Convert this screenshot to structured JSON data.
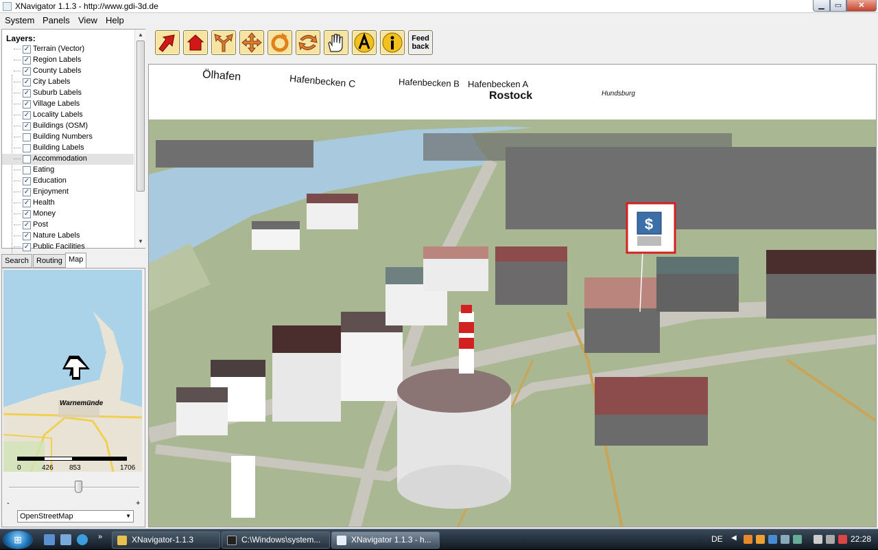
{
  "window": {
    "title": "XNavigator 1.1.3 - http://www.gdi-3d.de"
  },
  "menu": [
    "System",
    "Panels",
    "View",
    "Help"
  ],
  "layers": {
    "header": "Layers:",
    "items": [
      {
        "label": "Terrain (Vector)",
        "checked": true
      },
      {
        "label": "Region Labels",
        "checked": true
      },
      {
        "label": "County Labels",
        "checked": true
      },
      {
        "label": "City Labels",
        "checked": true
      },
      {
        "label": "Suburb Labels",
        "checked": true
      },
      {
        "label": "Village Labels",
        "checked": true
      },
      {
        "label": "Locality Labels",
        "checked": true
      },
      {
        "label": "Buildings (OSM)",
        "checked": true
      },
      {
        "label": "Building Numbers",
        "checked": false
      },
      {
        "label": "Building Labels",
        "checked": false
      },
      {
        "label": "Accommodation",
        "checked": false,
        "selected": true
      },
      {
        "label": "Eating",
        "checked": false
      },
      {
        "label": "Education",
        "checked": true
      },
      {
        "label": "Enjoyment",
        "checked": true
      },
      {
        "label": "Health",
        "checked": true
      },
      {
        "label": "Money",
        "checked": true
      },
      {
        "label": "Post",
        "checked": true
      },
      {
        "label": "Nature Labels",
        "checked": true
      },
      {
        "label": "Public Facilities",
        "checked": true
      }
    ]
  },
  "tabs": [
    "Search",
    "Routing",
    "Map"
  ],
  "active_tab": "Map",
  "minimap": {
    "place_label": "Warnemünde",
    "scale": [
      "0",
      "426",
      "853",
      "1706"
    ],
    "zoom_minus": "-",
    "zoom_plus": "+",
    "map_source": "OpenStreetMap"
  },
  "toolbar": {
    "feedback_label": "Feed back",
    "tools": [
      "fly-icon",
      "home-icon",
      "split-icon",
      "move-icon",
      "rotate-icon",
      "turn-icon",
      "hand-icon",
      "text-icon",
      "info-icon"
    ]
  },
  "scene": {
    "labels": [
      {
        "text": "Ölhafen"
      },
      {
        "text": "Hafenbecken C"
      },
      {
        "text": "Hafenbecken B"
      },
      {
        "text": "Hafenbecken A"
      },
      {
        "text": "Rostock"
      },
      {
        "text": "Hundsburg"
      }
    ]
  },
  "taskbar": {
    "tasks": [
      {
        "label": "XNavigator-1.1.3",
        "active": false
      },
      {
        "label": "C:\\Windows\\system...",
        "active": false
      },
      {
        "label": "XNavigator 1.1.3 - h...",
        "active": true
      }
    ],
    "lang": "DE",
    "clock": "22:28"
  },
  "colors": {
    "ground": "#a9b892",
    "water": "#a9c9df",
    "roads": "#c9c7bd",
    "sky": "#ffffff",
    "accent_red": "#d32020"
  }
}
